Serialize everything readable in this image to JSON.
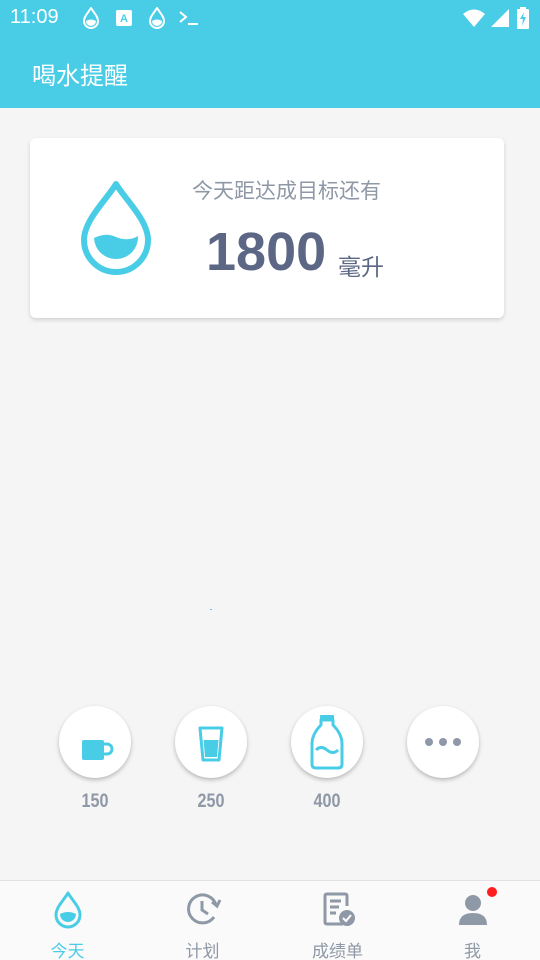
{
  "status_bar": {
    "time": "11:09",
    "icons": [
      "water-drop-icon",
      "app-icon",
      "water-drop-icon",
      "terminal-icon",
      "wifi-icon",
      "signal-icon",
      "battery-icon"
    ]
  },
  "app_bar": {
    "title": "喝水提醒"
  },
  "goal_card": {
    "label": "今天距达成目标还有",
    "amount": "1800",
    "unit": "毫升",
    "icon": "water-drop-icon"
  },
  "quick_add": [
    {
      "label": "150",
      "icon": "cup-icon"
    },
    {
      "label": "250",
      "icon": "glass-icon"
    },
    {
      "label": "400",
      "icon": "bottle-icon"
    },
    {
      "label": "",
      "icon": "more-icon"
    }
  ],
  "bottom_nav": [
    {
      "label": "今天",
      "icon": "water-drop-icon",
      "active": true
    },
    {
      "label": "计划",
      "icon": "clock-icon",
      "active": false
    },
    {
      "label": "成绩单",
      "icon": "report-icon",
      "active": false
    },
    {
      "label": "我",
      "icon": "user-icon",
      "active": false
    }
  ],
  "colors": {
    "accent": "#49cde6",
    "primary_text": "#5b6784",
    "secondary_text": "#8f98a6",
    "notification": "#ff1e1e"
  }
}
